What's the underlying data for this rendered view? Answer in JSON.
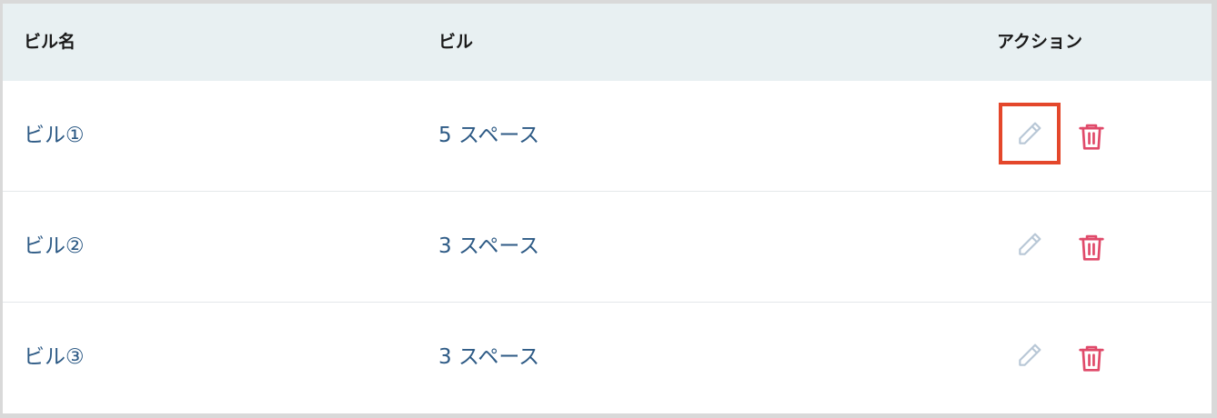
{
  "table": {
    "headers": {
      "name": "ビル名",
      "building": "ビル",
      "actions": "アクション"
    },
    "rows": [
      {
        "name": "ビル①",
        "spaces": "5 スペース",
        "edit_highlighted": true
      },
      {
        "name": "ビル②",
        "spaces": "3 スペース",
        "edit_highlighted": false
      },
      {
        "name": "ビル③",
        "spaces": "3 スペース",
        "edit_highlighted": false
      }
    ]
  },
  "icons": {
    "edit": "pencil-icon",
    "delete": "trash-icon"
  },
  "colors": {
    "header_bg": "#e8f0f2",
    "link_text": "#2d5a85",
    "edit_icon": "#b8c7d6",
    "delete_icon": "#e04a6a",
    "highlight_border": "#e4472b"
  }
}
